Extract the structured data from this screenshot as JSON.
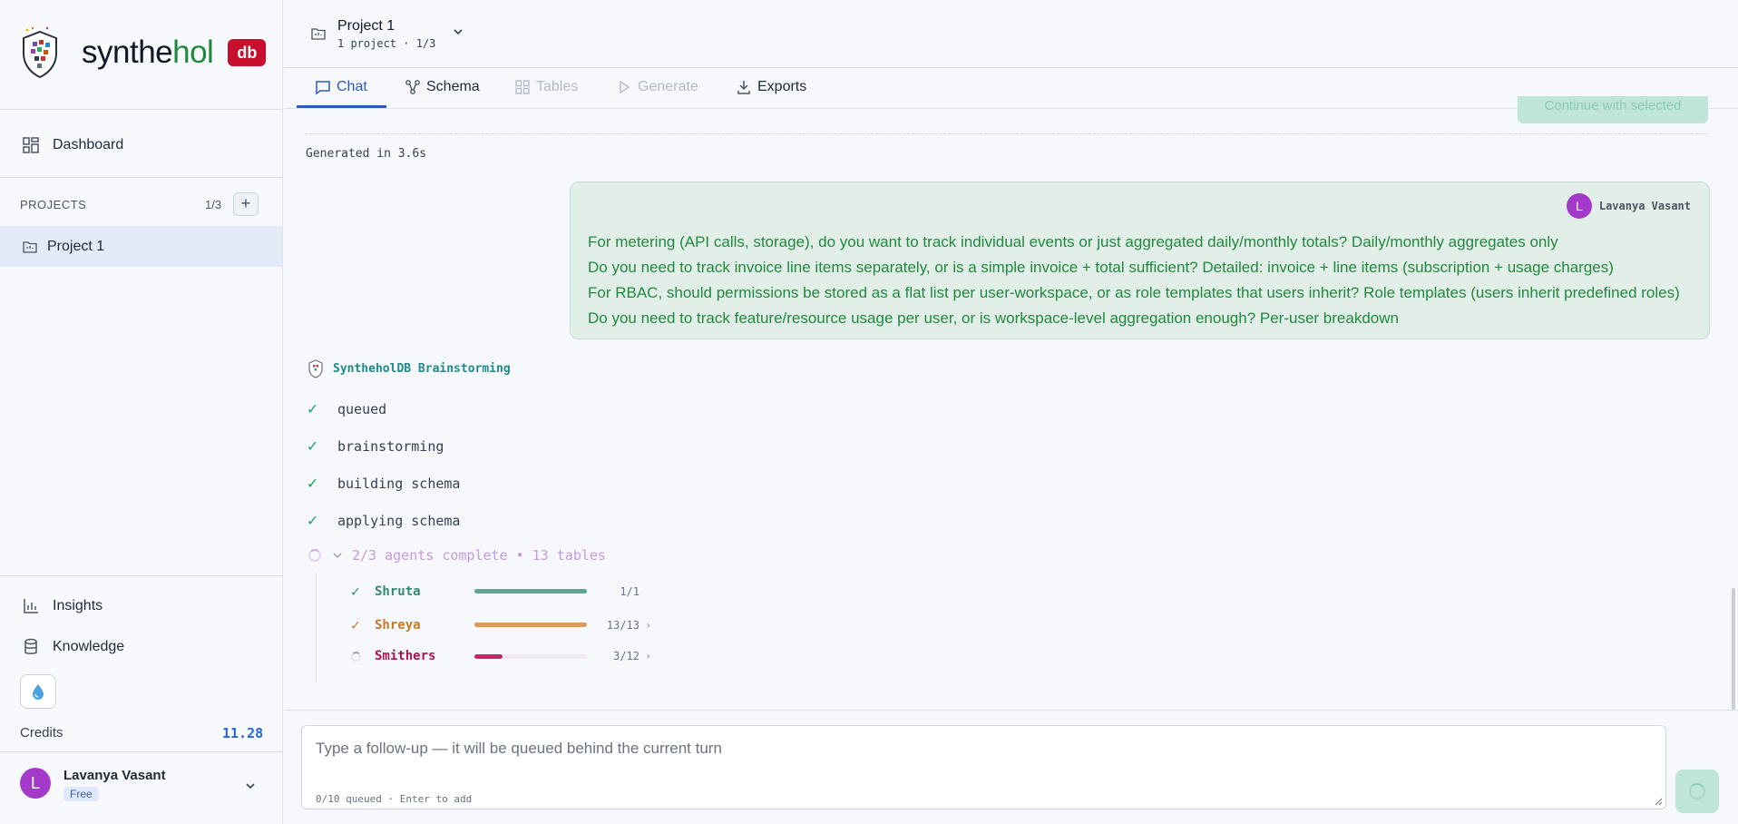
{
  "brand": {
    "name_part1": "synthe",
    "name_part2": "hol",
    "badge": "db"
  },
  "sidebar": {
    "dashboard_label": "Dashboard",
    "projects_label": "PROJECTS",
    "projects_count": "1/3",
    "add_project_symbol": "+",
    "project_item": "Project 1",
    "insights_label": "Insights",
    "knowledge_label": "Knowledge",
    "credits_label": "Credits",
    "credits_value": "11.28",
    "user": {
      "initial": "L",
      "name": "Lavanya Vasant",
      "plan": "Free"
    }
  },
  "header": {
    "project_title": "Project 1",
    "project_sub": "1 project · 1/3"
  },
  "tabs": [
    {
      "label": "Chat",
      "state": "active"
    },
    {
      "label": "Schema",
      "state": "enabled"
    },
    {
      "label": "Tables",
      "state": "disabled"
    },
    {
      "label": "Generate",
      "state": "disabled"
    },
    {
      "label": "Exports",
      "state": "enabled"
    }
  ],
  "chat": {
    "continue_button": "Continue with selected",
    "generated_time": "Generated in 3.6s",
    "user_message": {
      "initial": "L",
      "author": "Lavanya Vasant",
      "lines": [
        "For metering (API calls, storage), do you want to track individual events or just aggregated daily/monthly totals? Daily/monthly aggregates only",
        "Do you need to track invoice line items separately, or is a simple invoice + total sufficient? Detailed: invoice + line items (subscription + usage charges)",
        "For RBAC, should permissions be stored as a flat list per user-workspace, or as role templates that users inherit? Role templates (users inherit predefined roles)",
        "Do you need to track feature/resource usage per user, or is workspace-level aggregation enough? Per-user breakdown"
      ]
    },
    "bot_name": "SyntheholDB Brainstorming",
    "steps": [
      "queued",
      "brainstorming",
      "building schema",
      "applying schema"
    ],
    "agents_summary": "2/3 agents complete • 13 tables",
    "agents": [
      {
        "name": "Shruta",
        "count": "1/1",
        "progress": 1.0,
        "status": "done",
        "color": "#2f8a74",
        "bar_color": "#5aa894"
      },
      {
        "name": "Shreya",
        "count": "13/13",
        "progress": 1.0,
        "status": "done",
        "color": "#c47a2a",
        "bar_color": "#dc9a5a"
      },
      {
        "name": "Smithers",
        "count": "3/12",
        "progress": 0.25,
        "status": "running",
        "color": "#b0124f",
        "bar_color": "#c8246a"
      }
    ]
  },
  "composer": {
    "placeholder": "Type a follow-up — it will be queued behind the current turn",
    "meta": "0/10 queued · Enter to add"
  }
}
